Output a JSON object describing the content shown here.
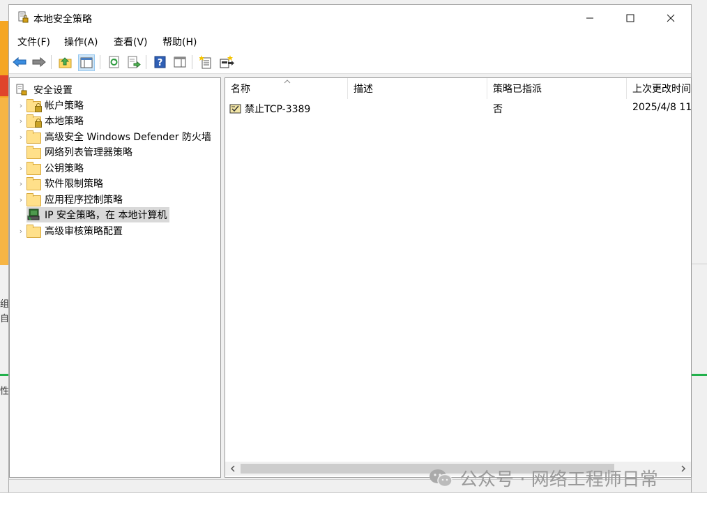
{
  "window": {
    "title": "本地安全策略"
  },
  "menu": [
    "文件(F)",
    "操作(A)",
    "查看(V)",
    "帮助(H)"
  ],
  "tree": {
    "root": "安全设置",
    "items": [
      {
        "label": "帐户策略",
        "expandable": true
      },
      {
        "label": "本地策略",
        "expandable": true
      },
      {
        "label": "高级安全 Windows Defender 防火墙",
        "expandable": true
      },
      {
        "label": "网络列表管理器策略",
        "expandable": false
      },
      {
        "label": "公钥策略",
        "expandable": true
      },
      {
        "label": "软件限制策略",
        "expandable": true
      },
      {
        "label": "应用程序控制策略",
        "expandable": true
      },
      {
        "label": "IP 安全策略，在 本地计算机",
        "expandable": false,
        "selected": true
      },
      {
        "label": "高级审核策略配置",
        "expandable": true
      }
    ]
  },
  "list": {
    "columns": [
      "名称",
      "描述",
      "策略已指派",
      "上次更改时间"
    ],
    "rows": [
      {
        "name": "禁止TCP-3389",
        "desc": "",
        "assigned": "否",
        "modified": "2025/4/8 11"
      }
    ]
  },
  "watermark": "公众号 · 网络工程师日常",
  "background_fragments": [
    "组",
    "自:",
    "性"
  ]
}
